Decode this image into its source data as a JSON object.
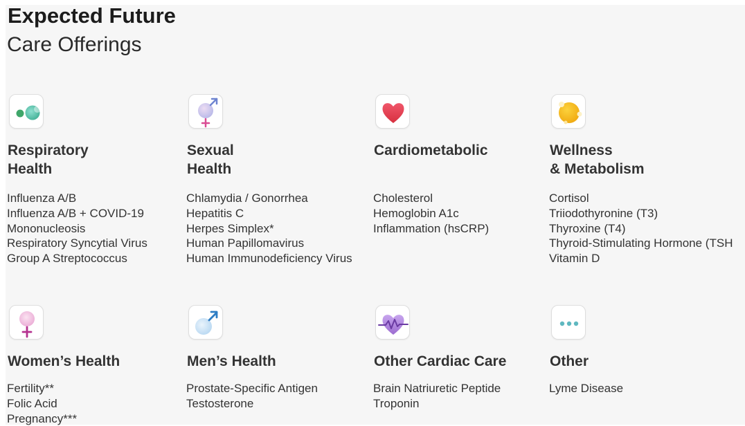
{
  "header": {
    "title": "Expected Future",
    "subtitle": "Care Offerings"
  },
  "categories": [
    {
      "icon": "respiratory-icon",
      "title_lines": [
        "Respiratory",
        "Health"
      ],
      "items": [
        "Influenza A/B",
        "Influenza A/B + COVID-19",
        "Mononucleosis",
        "Respiratory Syncytial Virus",
        "Group A Streptococcus"
      ]
    },
    {
      "icon": "sexual-health-icon",
      "title_lines": [
        "Sexual",
        "Health"
      ],
      "items": [
        "Chlamydia / Gonorrhea",
        "Hepatitis C",
        "Herpes Simplex*",
        "Human Papillomavirus",
        "Human Immunodeficiency Virus"
      ]
    },
    {
      "icon": "heart-icon",
      "title_lines": [
        "Cardiometabolic"
      ],
      "items": [
        "Cholesterol",
        "Hemoglobin A1c",
        "Inflammation (hsCRP)"
      ]
    },
    {
      "icon": "wellness-icon",
      "title_lines": [
        "Wellness",
        "& Metabolism"
      ],
      "items": [
        "Cortisol",
        "Triiodothyronine (T3)",
        "Thyroxine (T4)",
        "Thyroid-Stimulating Hormone (TSH",
        "Vitamin D"
      ]
    },
    {
      "icon": "female-symbol-icon",
      "title_lines": [
        "Women’s Health"
      ],
      "items": [
        "Fertility**",
        "Folic Acid",
        "Pregnancy***"
      ]
    },
    {
      "icon": "male-symbol-icon",
      "title_lines": [
        "Men’s Health"
      ],
      "items": [
        "Prostate-Specific Antigen",
        "Testosterone"
      ]
    },
    {
      "icon": "heart-pulse-icon",
      "title_lines": [
        "Other Cardiac Care"
      ],
      "items": [
        "Brain Natriuretic Peptide",
        "Troponin"
      ]
    },
    {
      "icon": "ellipsis-icon",
      "title_lines": [
        "Other"
      ],
      "items": [
        "Lyme Disease"
      ]
    }
  ],
  "colors": {
    "background": "#f6f6f6",
    "heading": "#1c1c1c",
    "text": "#333333",
    "respiratory_green": "#3fa66a",
    "respiratory_teal": "#7dd3c3",
    "heart_red": "#e8404f",
    "wellness_yellow": "#f6bb15",
    "female_magenta": "#b4318f",
    "male_blue": "#2d7dc4",
    "pulse_purple": "#9c6cd0",
    "dots_teal": "#5fb8c0"
  }
}
